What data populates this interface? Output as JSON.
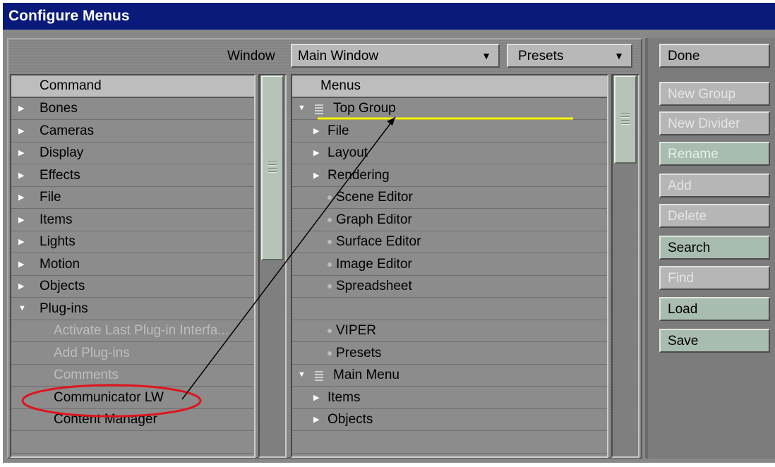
{
  "window": {
    "title": "Configure Menus"
  },
  "toolbar": {
    "window_label": "Window",
    "window_select": "Main Window",
    "presets_select": "Presets"
  },
  "command_panel": {
    "header": "Command",
    "items": [
      {
        "label": "Bones",
        "type": "collapsed"
      },
      {
        "label": "Cameras",
        "type": "collapsed"
      },
      {
        "label": "Display",
        "type": "collapsed"
      },
      {
        "label": "Effects",
        "type": "collapsed"
      },
      {
        "label": "File",
        "type": "collapsed"
      },
      {
        "label": "Items",
        "type": "collapsed"
      },
      {
        "label": "Lights",
        "type": "collapsed"
      },
      {
        "label": "Motion",
        "type": "collapsed"
      },
      {
        "label": "Objects",
        "type": "collapsed"
      },
      {
        "label": "Plug-ins",
        "type": "expanded"
      },
      {
        "label": "Activate Last Plug-in Interfa...",
        "type": "child-dim"
      },
      {
        "label": "Add Plug-ins",
        "type": "child-dim"
      },
      {
        "label": "Comments",
        "type": "child-dim"
      },
      {
        "label": "Communicator LW",
        "type": "child"
      },
      {
        "label": "Content Manager",
        "type": "child"
      },
      {
        "label": "",
        "type": "empty"
      }
    ]
  },
  "menus_panel": {
    "header": "Menus",
    "items": [
      {
        "label": "Top Group",
        "type": "group"
      },
      {
        "label": "File",
        "type": "sub"
      },
      {
        "label": "Layout",
        "type": "sub"
      },
      {
        "label": "Rendering",
        "type": "sub"
      },
      {
        "label": "Scene Editor",
        "type": "cmd"
      },
      {
        "label": "Graph Editor",
        "type": "cmd"
      },
      {
        "label": "Surface Editor",
        "type": "cmd"
      },
      {
        "label": "Image Editor",
        "type": "cmd"
      },
      {
        "label": "Spreadsheet",
        "type": "cmd"
      },
      {
        "label": "",
        "type": "empty"
      },
      {
        "label": "VIPER",
        "type": "cmd"
      },
      {
        "label": "Presets",
        "type": "cmd"
      },
      {
        "label": "Main Menu",
        "type": "group"
      },
      {
        "label": "Items",
        "type": "sub"
      },
      {
        "label": "Objects",
        "type": "sub"
      },
      {
        "label": "",
        "type": "empty"
      }
    ]
  },
  "buttons": {
    "done": "Done",
    "new_group": "New Group",
    "new_divider": "New Divider",
    "rename": "Rename",
    "add": "Add",
    "delete": "Delete",
    "search": "Search",
    "find": "Find",
    "load": "Load",
    "save": "Save"
  },
  "icons": {
    "dropdown": "chevron-down-icon",
    "collapsed": "triangle-right-icon",
    "expanded": "triangle-down-icon",
    "command": "dot-icon",
    "group": "group-lines-icon"
  },
  "colors": {
    "title_bar": "#0a1a7a",
    "annotation_circle": "#e0141e",
    "annotation_underline": "#ffff00",
    "annotation_arrow": "#000000"
  }
}
